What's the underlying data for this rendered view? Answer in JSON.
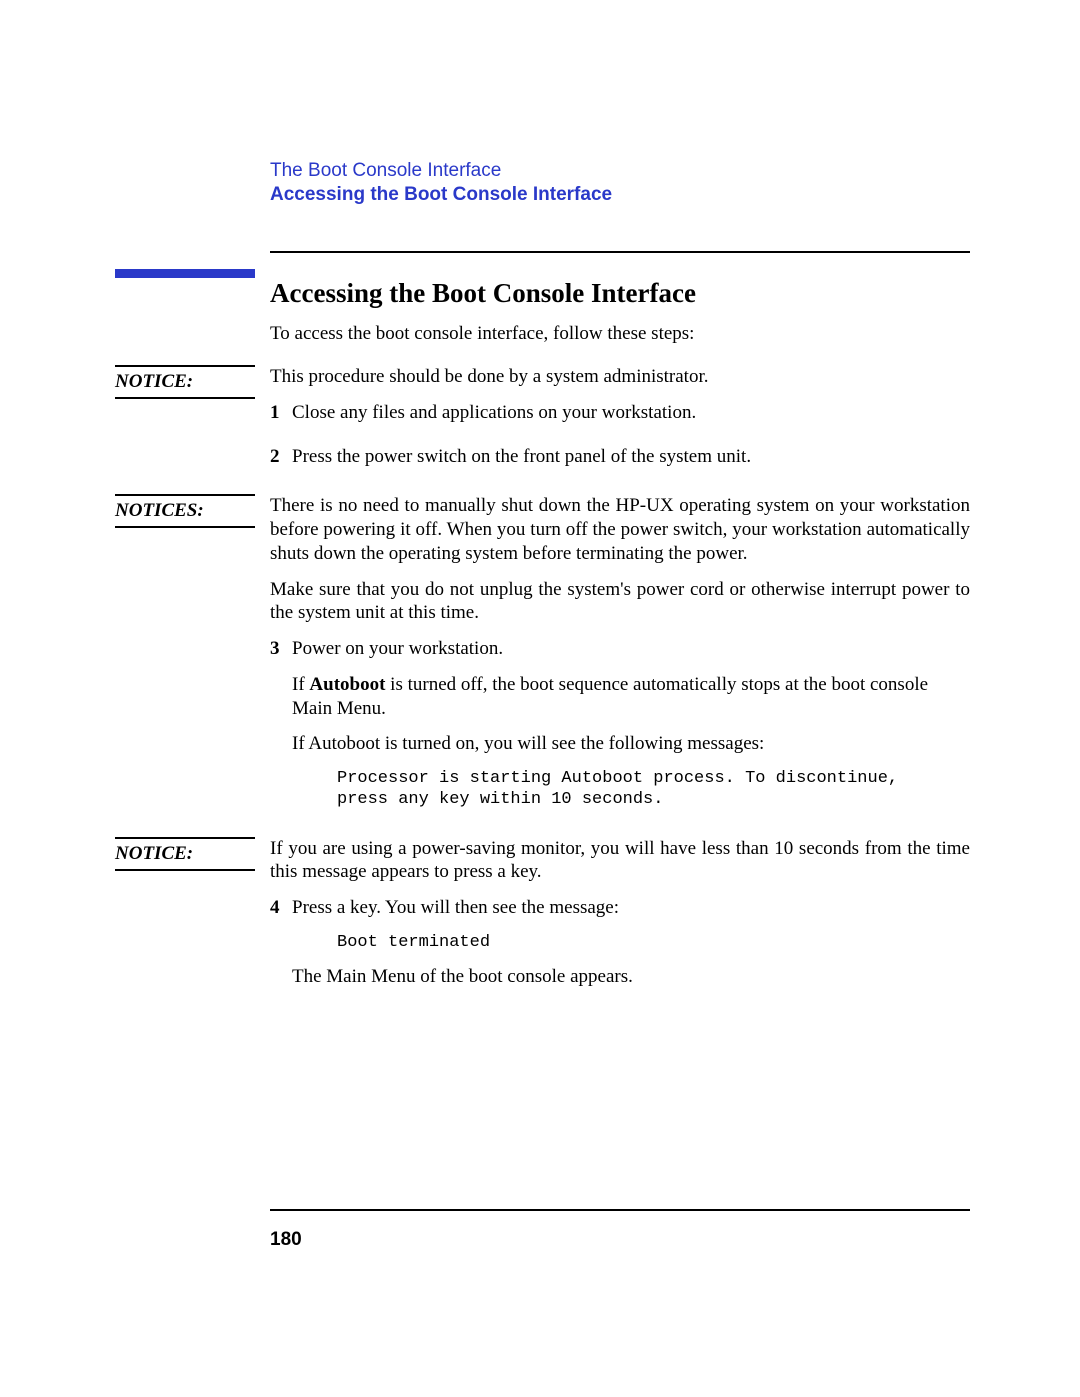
{
  "header": {
    "chapter": "The Boot Console Interface",
    "section": "Accessing the Boot Console Interface"
  },
  "title": "Accessing the Boot Console Interface",
  "intro": "To access the boot console interface, follow these steps:",
  "notice1": {
    "label": "NOTICE:",
    "text": "This procedure should be done by a system administrator."
  },
  "steps_a": [
    {
      "num": "1",
      "text": "Close any files and applications on your workstation."
    },
    {
      "num": "2",
      "text": "Press the power switch on the front panel of the system unit."
    }
  ],
  "notices2": {
    "label": "NOTICES:",
    "para1": "There is no need to manually shut down the HP-UX operating system on your workstation before powering it off. When you turn off the power switch, your workstation automatically shuts down the operating system before terminating the power.",
    "para2": "Make sure that you do not unplug the system's power cord or otherwise interrupt power to the system unit at this time."
  },
  "step3": {
    "num": "3",
    "line1": "Power on your workstation.",
    "para2_pre": "If ",
    "para2_bold": "Autoboot",
    "para2_post": " is turned off, the boot sequence automatically stops at the boot console Main Menu.",
    "para3": "If Autoboot is turned on, you will see the following messages:",
    "code": "Processor is starting Autoboot process. To discontinue,\npress any key within 10 seconds."
  },
  "notice3": {
    "label": "NOTICE:",
    "text": "If you are using a power-saving monitor, you will have less than 10 seconds from the time this message appears to press a key."
  },
  "step4": {
    "num": "4",
    "line1": "Press a key. You will then see the message:",
    "code": "Boot terminated",
    "line2": "The Main Menu of the boot console appears."
  },
  "page_number": "180"
}
